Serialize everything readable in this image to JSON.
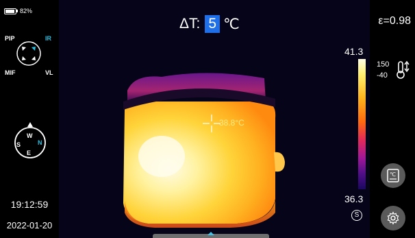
{
  "status": {
    "battery": "82%"
  },
  "fusion_modes": {
    "pip": "PIP",
    "ir": "IR",
    "mif": "MIF",
    "vl": "VL"
  },
  "compass": {
    "north": "N",
    "south": "S",
    "east": "E",
    "west": "W"
  },
  "clock": {
    "time": "19:12:59",
    "date": "2022-01-20"
  },
  "delta_t": {
    "label": "ΔT:",
    "value": "5",
    "unit": "℃"
  },
  "emissivity": "ε=0.98",
  "scale": {
    "max": "41.3",
    "min": "36.3",
    "mode_badge": "S"
  },
  "range": {
    "high": "150",
    "low": "-40"
  },
  "spot": {
    "temperature": "38.8°C"
  },
  "colors": {
    "accent": "#1e6fe8",
    "ir_active": "#27c0e0",
    "button": "#5a5a5a"
  },
  "icons": [
    "battery-icon",
    "fusion-mode-dial-icon",
    "compass-icon",
    "thermometer-range-icon",
    "celsius-unit-icon",
    "gear-icon",
    "crosshair-icon"
  ]
}
